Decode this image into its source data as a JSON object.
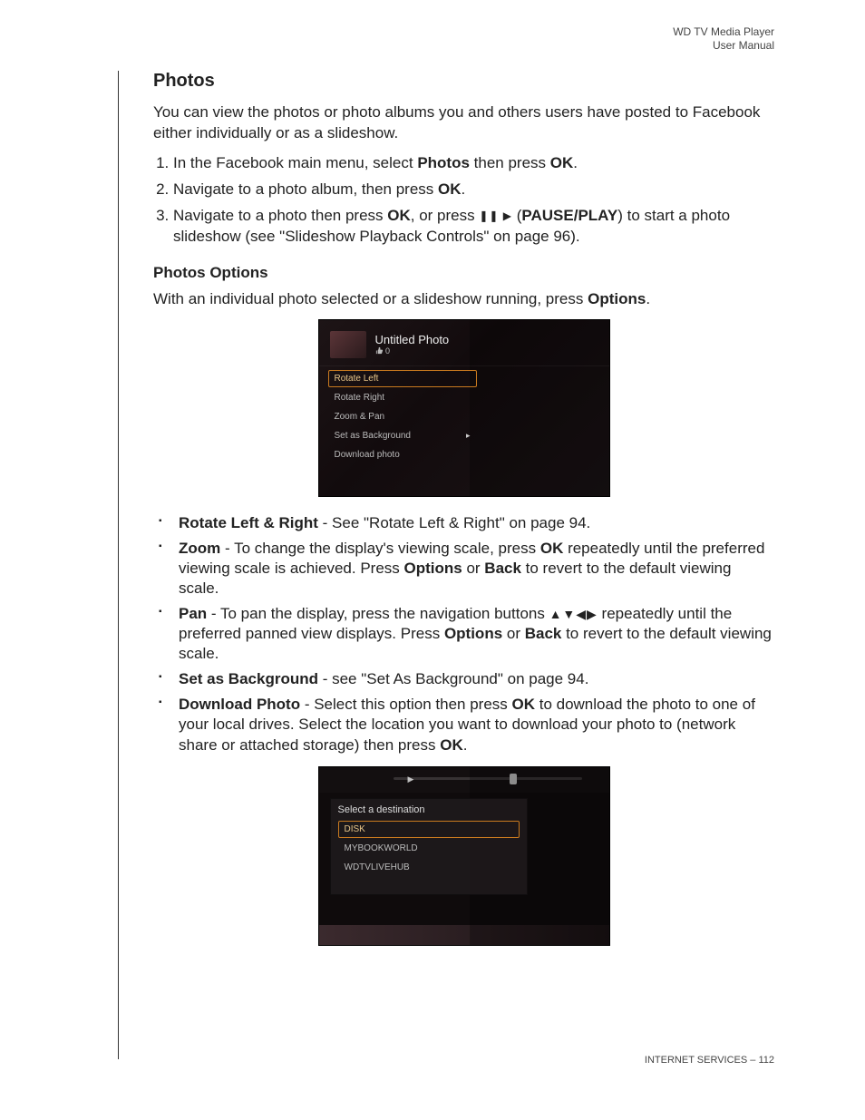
{
  "header": {
    "line1": "WD TV Media Player",
    "line2": "User Manual"
  },
  "section_title": "Photos",
  "intro": "You can view the photos or photo albums you and others users have posted to Facebook either individually or as a slideshow.",
  "steps": {
    "s1a": "In the Facebook main menu, select ",
    "s1b": "Photos",
    "s1c": " then press ",
    "s1d": "OK",
    "s1e": ".",
    "s2a": "Navigate to a photo album, then press ",
    "s2b": "OK",
    "s2c": ".",
    "s3a": "Navigate to a photo then press ",
    "s3b": "OK",
    "s3c": ", or press ",
    "s3d": "PAUSE/PLAY",
    "s3e": ") to start a photo slideshow (see \"Slideshow Playback Controls\" on page 96)."
  },
  "options_heading": "Photos Options",
  "options_intro_a": "With an individual photo selected or a slideshow running, press ",
  "options_intro_b": "Options",
  "options_intro_c": ".",
  "shot1": {
    "title": "Untitled Photo",
    "sub": "0",
    "items": [
      "Rotate Left",
      "Rotate Right",
      "Zoom & Pan",
      "Set as Background",
      "Download photo"
    ]
  },
  "bullets": {
    "b1a": "Rotate Left & Right",
    "b1b": " - See \"Rotate Left & Right\" on page 94.",
    "b2a": "Zoom",
    "b2b": " - To change the display's viewing scale, press ",
    "b2c": "OK",
    "b2d": " repeatedly until the preferred viewing scale is achieved. Press ",
    "b2e": "Options",
    "b2f": " or ",
    "b2g": "Back",
    "b2h": " to revert to the default viewing scale.",
    "b3a": "Pan",
    "b3b": " - To pan the display, press the navigation buttons ",
    "b3c": " repeatedly until the preferred panned view displays. Press ",
    "b3d": "Options",
    "b3e": " or ",
    "b3f": "Back",
    "b3g": " to revert to the default viewing scale.",
    "b4a": "Set as Background",
    "b4b": " - see \"Set As Background\" on page 94.",
    "b5a": "Download Photo",
    "b5b": " - Select this option then press ",
    "b5c": "OK",
    "b5d": " to download the photo to one of your local drives. Select the location you want to download your photo to (network share or attached storage) then press ",
    "b5e": "OK",
    "b5f": "."
  },
  "shot2": {
    "title": "Select a destination",
    "items": [
      "DISK",
      "MYBOOKWORLD",
      "WDTVLIVEHUB"
    ]
  },
  "footer": {
    "section": "INTERNET SERVICES",
    "sep": " – ",
    "page": "112"
  }
}
